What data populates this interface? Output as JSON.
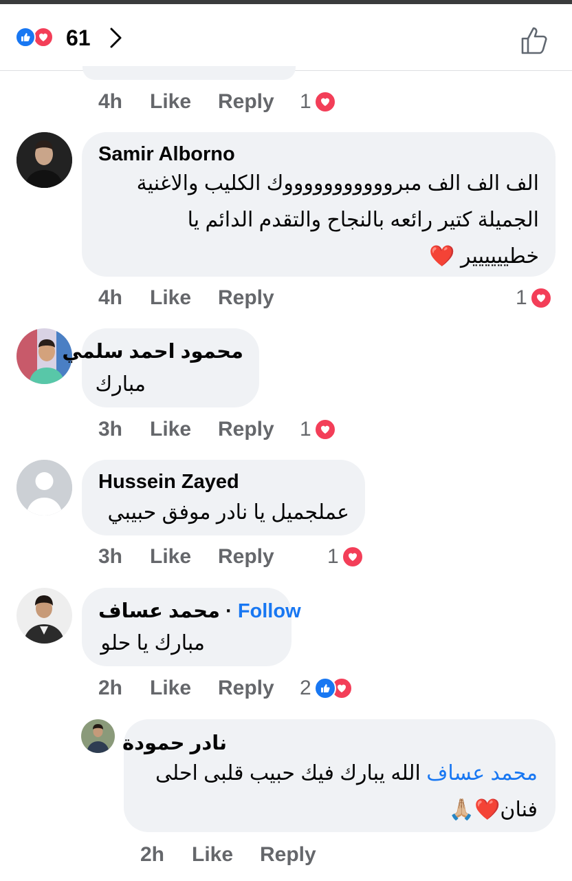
{
  "header": {
    "reaction_count": "61"
  },
  "labels": {
    "like": "Like",
    "reply": "Reply"
  },
  "comments": [
    {
      "time": "4h",
      "reactions": "1"
    },
    {
      "name": "Samir Alborno",
      "lines": [
        "الف الف الف مبروووووووووووك الكليب والاغنية",
        "الجميلة كتير رائعه بالنجاح والتقدم الدائم يا",
        "خطيييييير"
      ],
      "emoji": "❤️",
      "time": "4h",
      "reactions": "1"
    },
    {
      "name": "محمود احمد سلمي",
      "text": "مبارك",
      "time": "3h",
      "reactions": "1"
    },
    {
      "name": "Hussein Zayed",
      "text": "عملجميل يا نادر موفق حبيبي",
      "time": "3h",
      "reactions": "1"
    },
    {
      "name": "محمد عساف",
      "follow": "Follow",
      "separator": "·",
      "text": "مبارك يا حلو",
      "time": "2h",
      "reactions": "2"
    }
  ],
  "reply": {
    "name": "نادر حمودة",
    "mention": "محمد عساف",
    "line1": "الله يبارك فيك حبيب قلبى احلى",
    "line2": "فنان",
    "emoji": "❤️🙏🏼",
    "time": "2h"
  },
  "colors": {
    "like_blue": "#1877f2",
    "love_red": "#f33e58",
    "bubble_bg": "#f0f2f5",
    "meta_gray": "#65676b"
  }
}
